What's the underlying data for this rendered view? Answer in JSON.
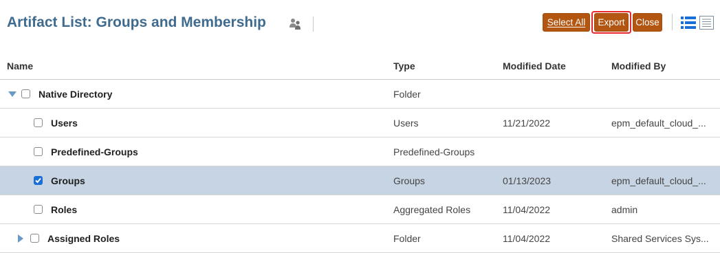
{
  "header": {
    "title": "Artifact List: Groups and Membership",
    "title_icon": "users-icon",
    "buttons": {
      "select_all": "Select All",
      "export": "Export",
      "close": "Close"
    },
    "view_icons": [
      "list-view-icon",
      "detail-view-icon"
    ]
  },
  "colors": {
    "title": "#3f6b8f",
    "button": "#b25612",
    "export_highlight": "#e8262b",
    "selected_row": "#c7d4e3",
    "checkbox_checked": "#1a6fd6",
    "icon_blue": "#1a6fd6"
  },
  "table": {
    "columns": [
      "Name",
      "Type",
      "Modified Date",
      "Modified By"
    ],
    "rows": [
      {
        "name": "Native Directory",
        "type": "Folder",
        "date": "",
        "by": "",
        "expander": "expanded",
        "checked": false,
        "selected": false,
        "indent": 0
      },
      {
        "name": "Users",
        "type": "Users",
        "date": "11/21/2022",
        "by": "epm_default_cloud_...",
        "expander": "none",
        "checked": false,
        "selected": false,
        "indent": 1
      },
      {
        "name": "Predefined-Groups",
        "type": "Predefined-Groups",
        "date": "",
        "by": "",
        "expander": "none",
        "checked": false,
        "selected": false,
        "indent": 1
      },
      {
        "name": "Groups",
        "type": "Groups",
        "date": "01/13/2023",
        "by": "epm_default_cloud_...",
        "expander": "none",
        "checked": true,
        "selected": true,
        "indent": 1
      },
      {
        "name": "Roles",
        "type": "Aggregated Roles",
        "date": "11/04/2022",
        "by": "admin",
        "expander": "none",
        "checked": false,
        "selected": false,
        "indent": 1
      },
      {
        "name": "Assigned Roles",
        "type": "Folder",
        "date": "11/04/2022",
        "by": "Shared Services Sys...",
        "expander": "collapsed",
        "checked": false,
        "selected": false,
        "indent": 1
      }
    ]
  }
}
